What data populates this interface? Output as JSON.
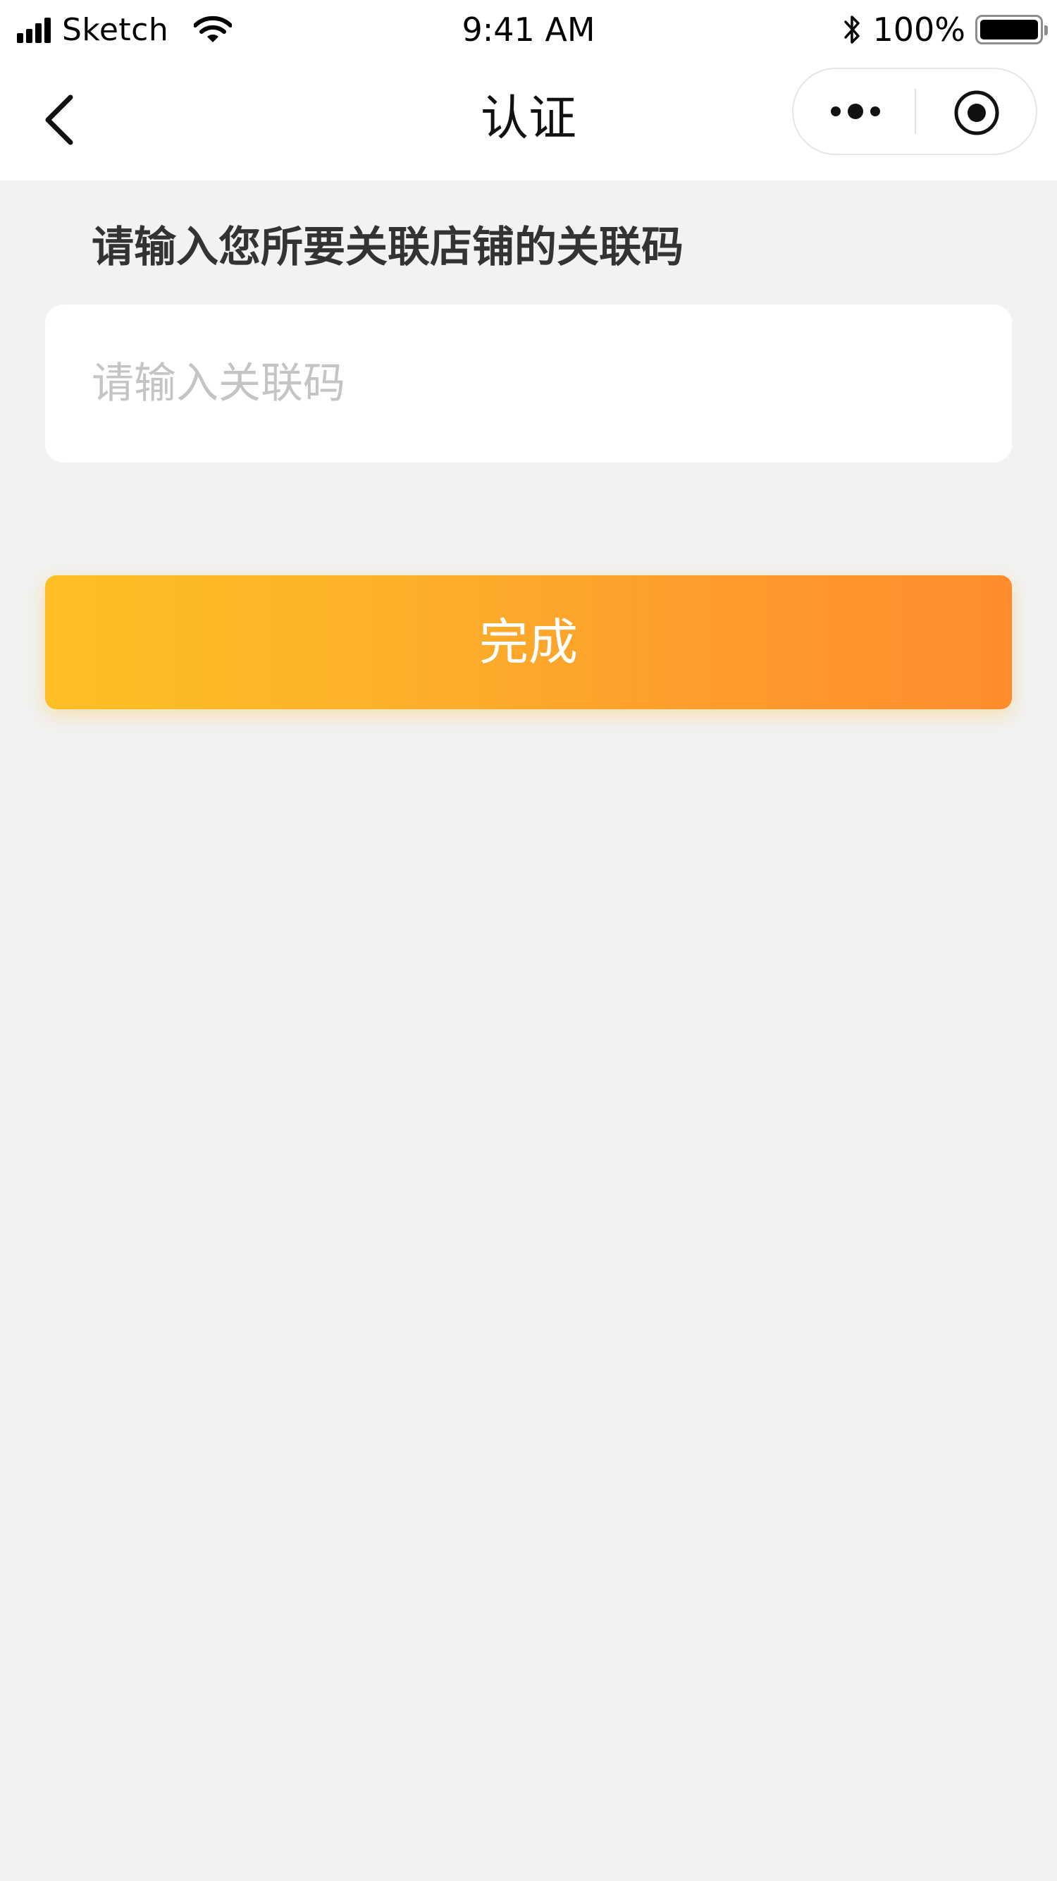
{
  "status_bar": {
    "carrier": "Sketch",
    "time": "9:41 AM",
    "battery": "100%",
    "battery_level_percent": 100,
    "icons": [
      "signal-icon",
      "wifi-icon",
      "bluetooth-icon",
      "battery-icon"
    ]
  },
  "nav": {
    "title": "认证",
    "back_icon": "chevron-left-icon",
    "capsule_icons": [
      "more-dots-icon",
      "close-target-icon"
    ]
  },
  "form": {
    "prompt": "请输入您所要关联店铺的关联码",
    "input_value": "",
    "input_placeholder": "请输入关联码",
    "submit_label": "完成"
  },
  "colors": {
    "page_background": "#f2f2f2",
    "button_gradient_start": "#fdbf23",
    "button_gradient_end": "#ff8c2c",
    "placeholder": "#c4c4c4",
    "prompt_text": "#333333"
  }
}
